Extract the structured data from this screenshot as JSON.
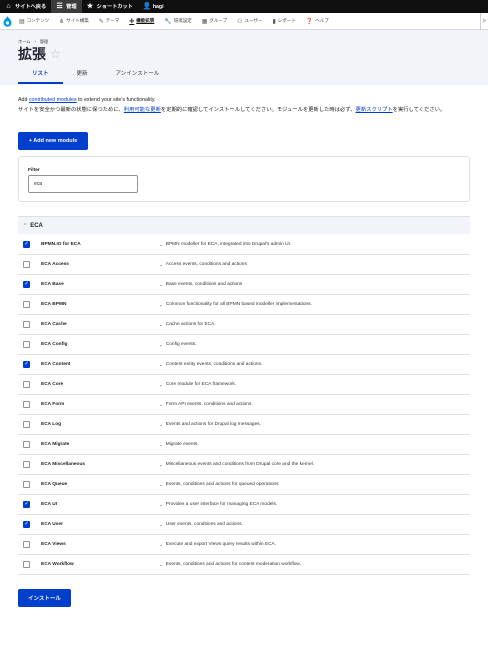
{
  "toolbar": {
    "back_site": "サイトへ戻る",
    "manage": "管理",
    "shortcuts": "ショートカット",
    "user": "hagi"
  },
  "admin_menu": {
    "items": [
      {
        "label": "コンテンツ",
        "icon": "document-icon"
      },
      {
        "label": "サイト構築",
        "icon": "structure-icon"
      },
      {
        "label": "テーマ",
        "icon": "brush-icon"
      },
      {
        "label": "機能拡張",
        "icon": "puzzle-icon",
        "active": true
      },
      {
        "label": "環境設定",
        "icon": "wrench-icon"
      },
      {
        "label": "グループ",
        "icon": "group-icon"
      },
      {
        "label": "ユーザー",
        "icon": "people-icon"
      },
      {
        "label": "レポート",
        "icon": "chart-icon"
      },
      {
        "label": "ヘルプ",
        "icon": "help-icon"
      }
    ]
  },
  "breadcrumb": {
    "home": "ホーム",
    "sep": "›",
    "admin": "管理"
  },
  "page": {
    "title": "拡張"
  },
  "tabs": [
    {
      "label": "リスト",
      "active": true
    },
    {
      "label": "更新"
    },
    {
      "label": "アンインストール"
    }
  ],
  "intro": {
    "line1_pre": "Add ",
    "line1_link": "contributed modules",
    "line1_post": " to extend your site's functionality.",
    "line2_pre": "サイトを安全かつ最新の状態に保つために、",
    "line2_link": "利用可能な更新",
    "line2_mid": "を定期的に確認してインストールしてください。モジュールを更新した時は必ず、",
    "line2_link2": "更新スクリプト",
    "line2_post": "を実行してください。"
  },
  "add_button": "+ Add new module",
  "filter": {
    "label": "Filter",
    "value": "eca"
  },
  "package": {
    "name": "ECA"
  },
  "modules": [
    {
      "name": "BPMN.IO for ECA",
      "desc": "BPMN modeller for ECA, integrated into Drupal's admin UI.",
      "checked": true
    },
    {
      "name": "ECA Access",
      "desc": "Access events, conditions and actions",
      "checked": false
    },
    {
      "name": "ECA Base",
      "desc": "Base events, conditions and actions",
      "checked": true
    },
    {
      "name": "ECA BPMN",
      "desc": "Common functionality for all BPMN based modeller implementations.",
      "checked": false
    },
    {
      "name": "ECA Cache",
      "desc": "Cache actions for ECA.",
      "checked": false
    },
    {
      "name": "ECA Config",
      "desc": "Config events.",
      "checked": false
    },
    {
      "name": "ECA Content",
      "desc": "Content entity events, conditions and actions.",
      "checked": true
    },
    {
      "name": "ECA Core",
      "desc": "Core module for ECA framework.",
      "checked": false
    },
    {
      "name": "ECA Form",
      "desc": "Form API events, conditions and actions.",
      "checked": false
    },
    {
      "name": "ECA Log",
      "desc": "Events and actions for Drupal log messages.",
      "checked": false
    },
    {
      "name": "ECA Migrate",
      "desc": "Migrate events.",
      "checked": false
    },
    {
      "name": "ECA Miscellaneous",
      "desc": "Miscellaneous events and conditions from Drupal core and the kernel.",
      "checked": false
    },
    {
      "name": "ECA Queue",
      "desc": "Events, conditions and actions for queued operations",
      "checked": false
    },
    {
      "name": "ECA UI",
      "desc": "Provides a user interface for managing ECA models.",
      "checked": true
    },
    {
      "name": "ECA User",
      "desc": "User events, conditions and actions.",
      "checked": true
    },
    {
      "name": "ECA Views",
      "desc": "Execute and export Views query results within ECA.",
      "checked": false
    },
    {
      "name": "ECA Workflow",
      "desc": "Events, conditions and actions for content moderation workflow.",
      "checked": false
    }
  ],
  "install_button": "インストール",
  "colors": {
    "accent": "#003ecc",
    "toolbar": "#0f0f0f",
    "header_bg": "#f3f4f9"
  }
}
